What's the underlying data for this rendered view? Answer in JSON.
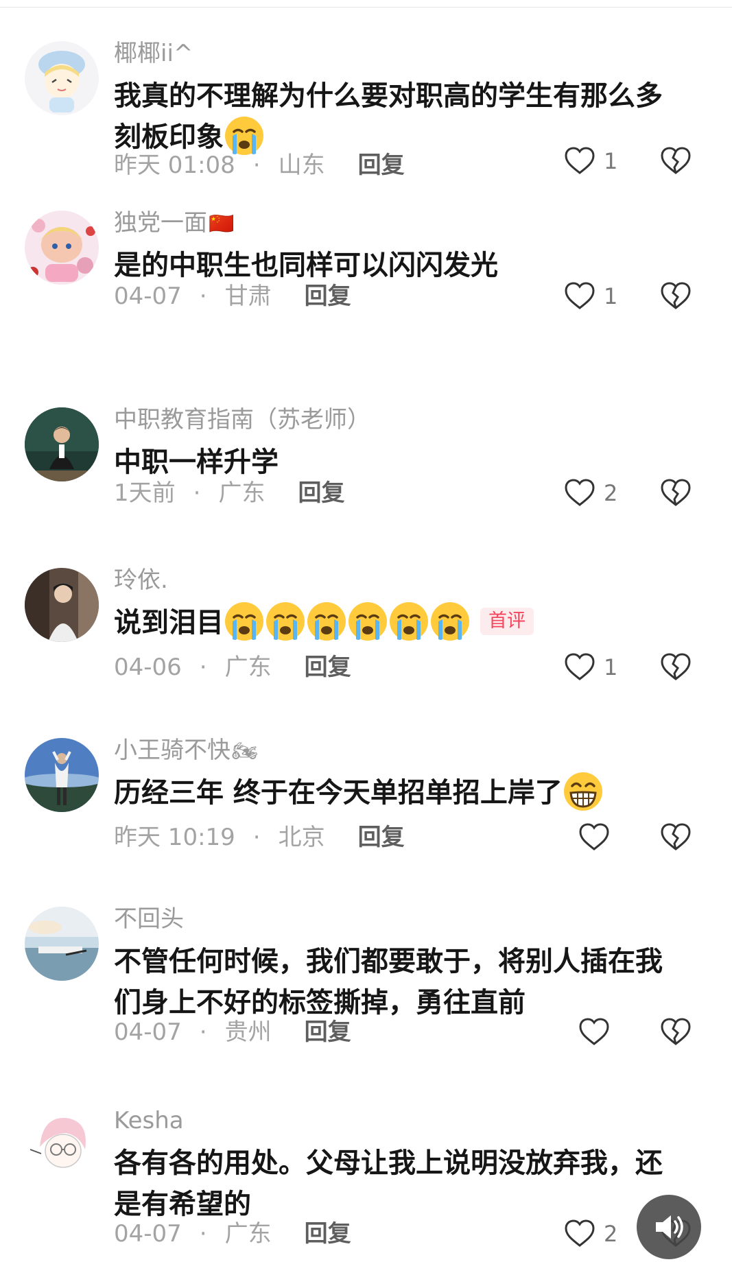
{
  "comments": [
    {
      "username": "椰椰ii^",
      "username_emoji": "",
      "text": "我真的不理解为什么要对职高的学生有那么多刻板印象",
      "text_emojis": [
        "loudly-crying-face"
      ],
      "first_badge": "",
      "time": "昨天 01:08",
      "region": "山东",
      "reply": "回复",
      "likes": "1"
    },
    {
      "username": "独党一面",
      "username_emoji": "🇨🇳",
      "text": "是的中职生也同样可以闪闪发光",
      "text_emojis": [],
      "first_badge": "",
      "time": "04-07",
      "region": "甘肃",
      "reply": "回复",
      "likes": "1"
    },
    {
      "username": "中职教育指南（苏老师）",
      "username_emoji": "",
      "text": "中职一样升学",
      "text_emojis": [],
      "first_badge": "",
      "time": "1天前",
      "region": "广东",
      "reply": "回复",
      "likes": "2"
    },
    {
      "username": "玲依.",
      "username_emoji": "",
      "text": "说到泪目",
      "text_emojis": [
        "loudly-crying-face",
        "loudly-crying-face",
        "loudly-crying-face",
        "loudly-crying-face",
        "loudly-crying-face",
        "loudly-crying-face"
      ],
      "first_badge": "首评",
      "time": "04-06",
      "region": "广东",
      "reply": "回复",
      "likes": "1"
    },
    {
      "username": "小王骑不快",
      "username_emoji": "🏍",
      "text": "历经三年 终于在今天单招单招上岸了",
      "text_emojis": [
        "grinning-face"
      ],
      "first_badge": "",
      "time": "昨天 10:19",
      "region": "北京",
      "reply": "回复",
      "likes": ""
    },
    {
      "username": "不回头",
      "username_emoji": "",
      "text": "不管任何时候，我们都要敢于，将别人插在我们身上不好的标签撕掉，勇往直前",
      "text_emojis": [],
      "first_badge": "",
      "time": "04-07",
      "region": "贵州",
      "reply": "回复",
      "likes": ""
    },
    {
      "username": "Kesha",
      "username_emoji": "",
      "text": "各有各的用处。父母让我上说明没放弃我，还是有希望的",
      "text_emojis": [],
      "first_badge": "",
      "time": "04-07",
      "region": "广东",
      "reply": "回复",
      "likes": "2"
    }
  ],
  "icons": {
    "like": "heart-outline-icon",
    "dislike": "broken-heart-icon",
    "sound": "speaker-icon"
  }
}
